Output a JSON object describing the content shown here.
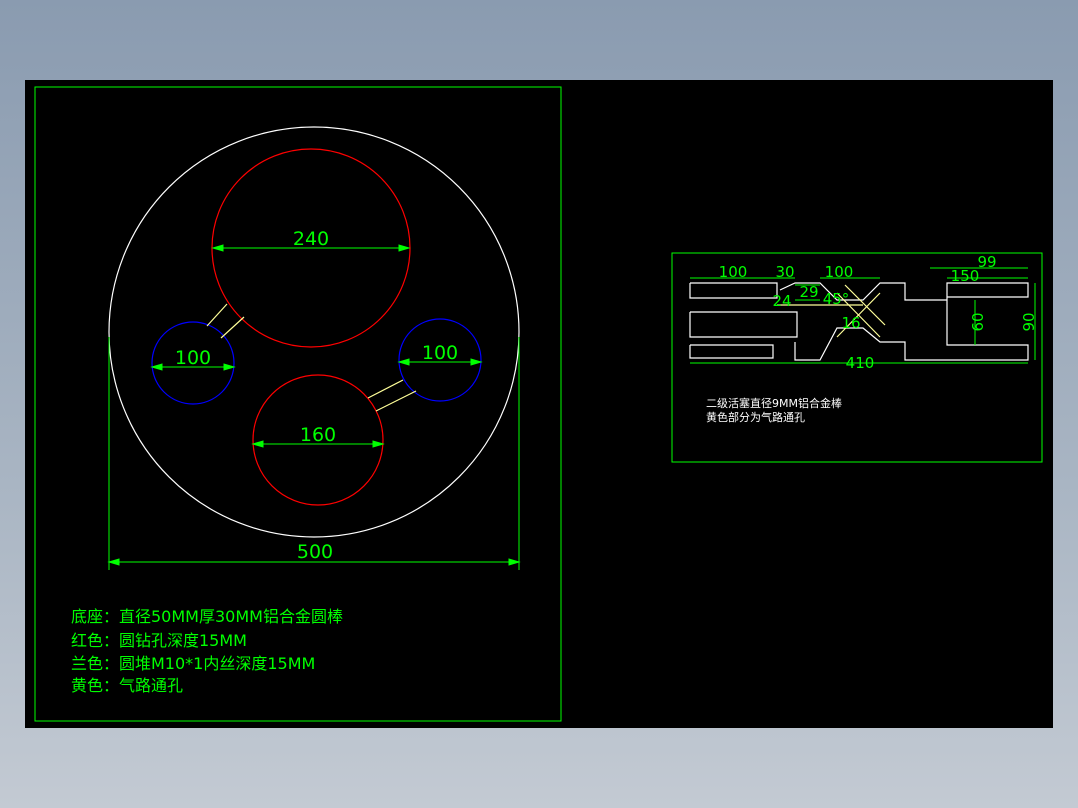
{
  "colors": {
    "background": "#000000",
    "frame": "#00ff00",
    "outline": "#ffffff",
    "red_holes": "#ff0000",
    "blue_holes": "#0000ff",
    "air_passages": "#ffff66",
    "dimensions": "#00ff00"
  },
  "base_drawing": {
    "dims": {
      "large_red": "240",
      "left_blue": "100",
      "right_blue": "100",
      "small_red": "160",
      "overall": "500"
    },
    "notes": [
      "底座：直径50MM厚30MM铝合金圆棒",
      "红色：圆钻孔深度15MM",
      "兰色：圆堆M10*1内丝深度15MM",
      "黄色：气路通孔"
    ]
  },
  "piston_drawing": {
    "dims": {
      "len_left": "100",
      "len_30": "30",
      "len_mid": "100",
      "len_150": "150",
      "len_99": "99",
      "dia_24": "24",
      "dia_29": "29",
      "angle_45": "45°",
      "dia_16": "16",
      "dia_60": "60",
      "dia_90": "90",
      "total_410": "410"
    },
    "notes": [
      "二级活塞直径9MM铝合金棒",
      "黄色部分为气路通孔"
    ]
  }
}
